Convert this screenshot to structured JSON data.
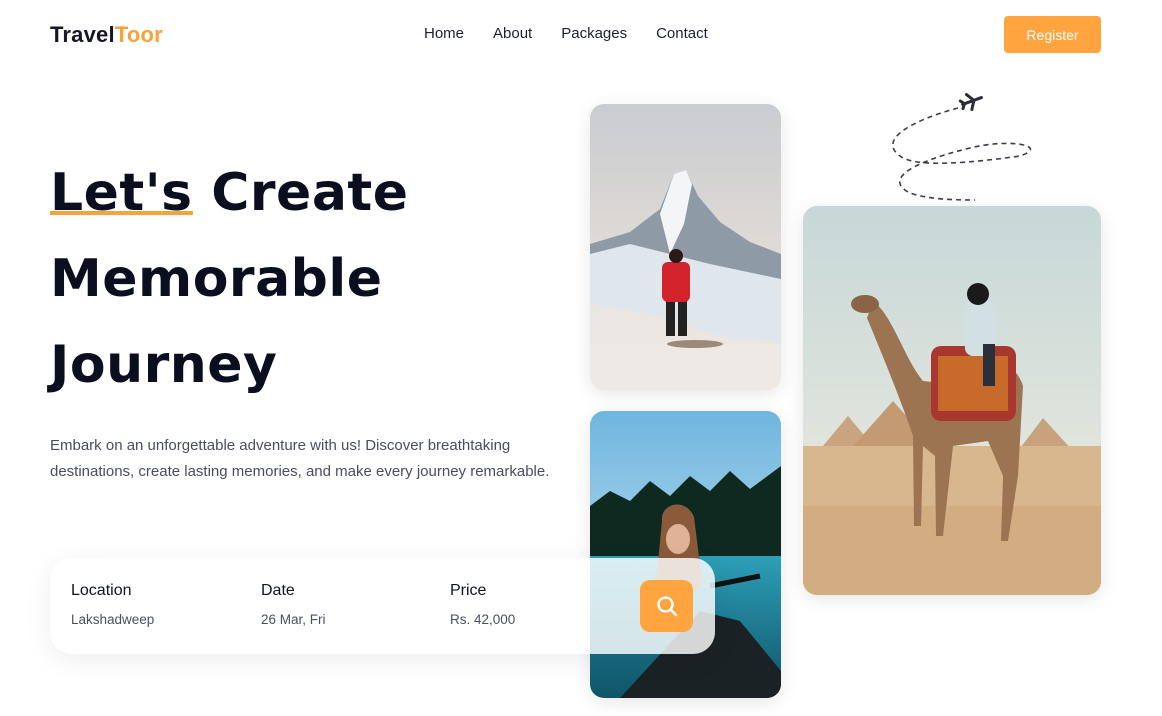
{
  "brand": {
    "name_part1": "Travel",
    "name_part2": "Toor",
    "accent": "#f7a23b"
  },
  "nav": {
    "items": [
      "Home",
      "About",
      "Packages",
      "Contact"
    ]
  },
  "header": {
    "register_label": "Register"
  },
  "hero": {
    "headline_underlined": "Let's",
    "headline_line1_rest": " Create",
    "headline_line2": "Memorable",
    "headline_line3": "Journey",
    "description": "Embark on an unforgettable adventure with us! Discover breathtaking destinations, create lasting memories, and make every journey remarkable."
  },
  "search": {
    "location_label": "Location",
    "location_value": "Lakshadweep",
    "date_label": "Date",
    "date_value": "26 Mar, Fri",
    "price_label": "Price",
    "price_value": "Rs. 42,000",
    "button_icon": "search-icon"
  },
  "images": [
    "mountain-hiker-photo",
    "lake-kayak-photo",
    "camel-pyramids-photo"
  ],
  "decor": {
    "icon": "airplane-icon"
  }
}
